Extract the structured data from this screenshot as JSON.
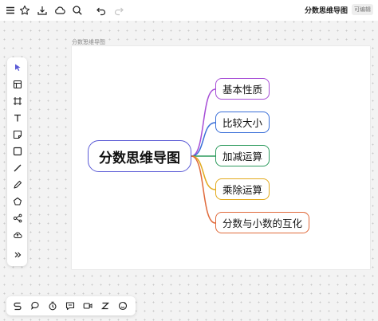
{
  "toolbar_top": {
    "icons": [
      "menu-icon",
      "star-icon",
      "download-icon",
      "cloud-icon",
      "search-icon",
      "undo-icon",
      "redo-icon"
    ],
    "title": "分数思维导图",
    "badge": "可编辑"
  },
  "canvas": {
    "frame_label": "分数思维导图"
  },
  "left_tools": [
    "select-tool-icon",
    "template-icon",
    "frame-icon",
    "text-icon",
    "sticky-note-icon",
    "rectangle-icon",
    "line-icon",
    "pen-icon",
    "polygon-icon",
    "mindmap-icon",
    "upload-icon",
    "more-icon"
  ],
  "bottom_tools": [
    "connector-icon",
    "comment-icon",
    "timer-icon",
    "chat-icon",
    "video-icon",
    "sleep-icon",
    "reaction-icon"
  ],
  "mindmap": {
    "root": "分数思维导图",
    "root_color": "#5b5bd6",
    "children": [
      {
        "label": "基本性质",
        "color": "#a64dd6"
      },
      {
        "label": "比较大小",
        "color": "#3a6fd8"
      },
      {
        "label": "加减运算",
        "color": "#2e9b5e"
      },
      {
        "label": "乘除运算",
        "color": "#e2a91b"
      },
      {
        "label": "分数与小数的互化",
        "color": "#e06a3b"
      }
    ]
  },
  "colors": {
    "accent": "#5b5bd6"
  }
}
